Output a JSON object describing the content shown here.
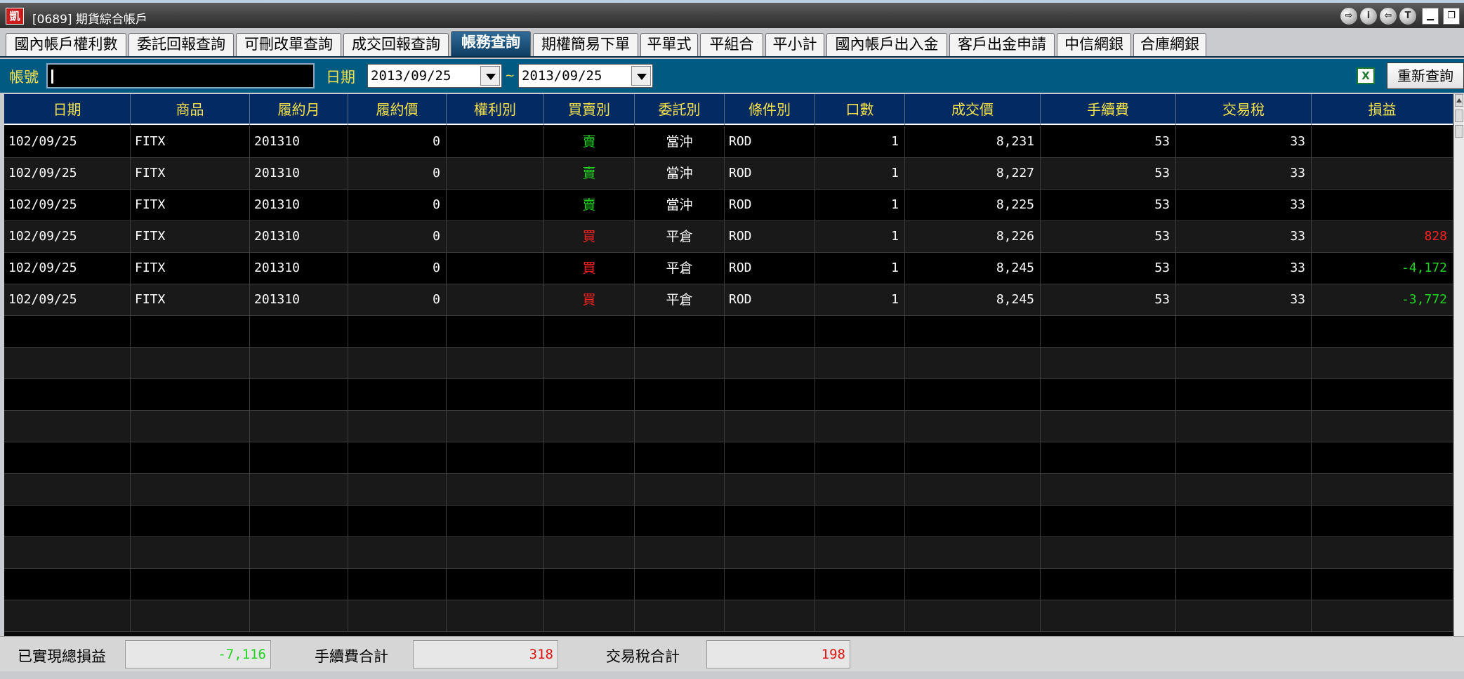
{
  "window": {
    "icon_text": "凱",
    "title": "[0689] 期貨綜合帳戶",
    "circle_buttons": [
      "⇨",
      "i",
      "⇦",
      "T"
    ],
    "minimize": "▁",
    "restore": "❐"
  },
  "tabs": [
    {
      "label": "國內帳戶權利數",
      "active": false
    },
    {
      "label": "委託回報查詢",
      "active": false
    },
    {
      "label": "可刪改單查詢",
      "active": false
    },
    {
      "label": "成交回報查詢",
      "active": false
    },
    {
      "label": "帳務查詢",
      "active": true
    },
    {
      "label": "期權簡易下單",
      "active": false
    },
    {
      "label": "平單式",
      "active": false
    },
    {
      "label": "平組合",
      "active": false
    },
    {
      "label": "平小計",
      "active": false
    },
    {
      "label": "國內帳戶出入金",
      "active": false
    },
    {
      "label": "客戶出金申請",
      "active": false
    },
    {
      "label": "中信網銀",
      "active": false
    },
    {
      "label": "合庫網銀",
      "active": false
    }
  ],
  "query": {
    "account_label": "帳號",
    "account_value": "",
    "date_label": "日期",
    "date_from": "2013/09/25",
    "date_to": "2013/09/25",
    "range_sep": "~",
    "export_icon": "excel-icon",
    "requery_label": "重新查詢"
  },
  "grid": {
    "columns": [
      "日期",
      "商品",
      "履約月",
      "履約價",
      "權利別",
      "買賣別",
      "委託別",
      "條件別",
      "口數",
      "成交價",
      "手續費",
      "交易稅",
      "損益"
    ],
    "rows": [
      {
        "date": "102/09/25",
        "product": "FITX",
        "month": "201310",
        "strike": "0",
        "right": "",
        "side": "賣",
        "side_color": "#1fd31f",
        "order_type": "當沖",
        "cond": "ROD",
        "qty": "1",
        "price": "8,231",
        "fee": "53",
        "tax": "33",
        "pnl": "",
        "pnl_color": "#ffffff"
      },
      {
        "date": "102/09/25",
        "product": "FITX",
        "month": "201310",
        "strike": "0",
        "right": "",
        "side": "賣",
        "side_color": "#1fd31f",
        "order_type": "當沖",
        "cond": "ROD",
        "qty": "1",
        "price": "8,227",
        "fee": "53",
        "tax": "33",
        "pnl": "",
        "pnl_color": "#ffffff"
      },
      {
        "date": "102/09/25",
        "product": "FITX",
        "month": "201310",
        "strike": "0",
        "right": "",
        "side": "賣",
        "side_color": "#1fd31f",
        "order_type": "當沖",
        "cond": "ROD",
        "qty": "1",
        "price": "8,225",
        "fee": "53",
        "tax": "33",
        "pnl": "",
        "pnl_color": "#ffffff"
      },
      {
        "date": "102/09/25",
        "product": "FITX",
        "month": "201310",
        "strike": "0",
        "right": "",
        "side": "買",
        "side_color": "#ff2020",
        "order_type": "平倉",
        "cond": "ROD",
        "qty": "1",
        "price": "8,226",
        "fee": "53",
        "tax": "33",
        "pnl": "828",
        "pnl_color": "#ff2020"
      },
      {
        "date": "102/09/25",
        "product": "FITX",
        "month": "201310",
        "strike": "0",
        "right": "",
        "side": "買",
        "side_color": "#ff2020",
        "order_type": "平倉",
        "cond": "ROD",
        "qty": "1",
        "price": "8,245",
        "fee": "53",
        "tax": "33",
        "pnl": "-4,172",
        "pnl_color": "#1fd31f"
      },
      {
        "date": "102/09/25",
        "product": "FITX",
        "month": "201310",
        "strike": "0",
        "right": "",
        "side": "買",
        "side_color": "#ff2020",
        "order_type": "平倉",
        "cond": "ROD",
        "qty": "1",
        "price": "8,245",
        "fee": "53",
        "tax": "33",
        "pnl": "-3,772",
        "pnl_color": "#1fd31f"
      }
    ],
    "empty_rows": 10
  },
  "footer": {
    "realized_label": "已實現總損益",
    "realized_value": "-7,116",
    "realized_color": "#1fd31f",
    "fee_label": "手續費合計",
    "fee_value": "318",
    "fee_color": "#e01010",
    "tax_label": "交易稅合計",
    "tax_value": "198",
    "tax_color": "#e01010"
  }
}
